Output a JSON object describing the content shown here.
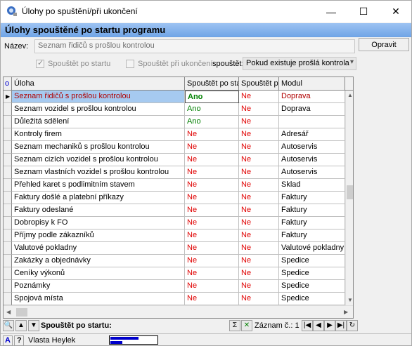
{
  "window": {
    "title": "Úlohy po spuštění/při ukončení",
    "minimize": "—",
    "maximize": "☐",
    "close": "✕"
  },
  "section_header": "Úlohy spouštěné po startu programu",
  "form": {
    "name_label": "Název:",
    "name_value": "Seznam řidičů s prošlou kontrolou",
    "open_button": "Opravit",
    "run_on_start_label": "Spouštět po startu",
    "run_on_start_checked": true,
    "run_on_exit_label": "Spouštět při ukončení",
    "run_on_exit_checked": false,
    "run_condition_label": "spouštět:",
    "run_condition_value": "Pokud existuje prošlá kontrola"
  },
  "grid": {
    "indicator_header": "o",
    "columns": [
      "Úloha",
      "Spouštět po sta",
      "Spouštět pi",
      "Modul"
    ],
    "rows": [
      {
        "task": "Seznam řidičů s prošlou kontrolou",
        "start": "Ano",
        "exit": "Ne",
        "module": "Doprava",
        "selected": true
      },
      {
        "task": "Seznam vozidel s prošlou kontrolou",
        "start": "Ano",
        "exit": "Ne",
        "module": "Doprava"
      },
      {
        "task": "Důležitá sdělení",
        "start": "Ano",
        "exit": "Ne",
        "module": ""
      },
      {
        "task": "Kontroly firem",
        "start": "Ne",
        "exit": "Ne",
        "module": "Adresář"
      },
      {
        "task": "Seznam mechaniků s prošlou kontrolou",
        "start": "Ne",
        "exit": "Ne",
        "module": "Autoservis"
      },
      {
        "task": "Seznam cizích vozidel s prošlou kontrolou",
        "start": "Ne",
        "exit": "Ne",
        "module": "Autoservis"
      },
      {
        "task": "Seznam vlastních vozidel s prošlou kontrolou",
        "start": "Ne",
        "exit": "Ne",
        "module": "Autoservis"
      },
      {
        "task": "Přehled karet s podlimitním stavem",
        "start": "Ne",
        "exit": "Ne",
        "module": "Sklad"
      },
      {
        "task": "Faktury došlé a platební příkazy",
        "start": "Ne",
        "exit": "Ne",
        "module": "Faktury"
      },
      {
        "task": "Faktury odeslané",
        "start": "Ne",
        "exit": "Ne",
        "module": "Faktury"
      },
      {
        "task": "Dobropisy k FO",
        "start": "Ne",
        "exit": "Ne",
        "module": "Faktury"
      },
      {
        "task": "Příjmy podle zákazníků",
        "start": "Ne",
        "exit": "Ne",
        "module": "Faktury"
      },
      {
        "task": "Valutové pokladny",
        "start": "Ne",
        "exit": "Ne",
        "module": "Valutové pokladny"
      },
      {
        "task": "Zakázky a objednávky",
        "start": "Ne",
        "exit": "Ne",
        "module": "Spedice"
      },
      {
        "task": "Ceníky výkonů",
        "start": "Ne",
        "exit": "Ne",
        "module": "Spedice"
      },
      {
        "task": "Poznámky",
        "start": "Ne",
        "exit": "Ne",
        "module": "Spedice"
      },
      {
        "task": "Spojová místa",
        "start": "Ne",
        "exit": "Ne",
        "module": "Spedice"
      }
    ]
  },
  "navbar": {
    "search_icon": "🔍",
    "up": "▲",
    "down": "▼",
    "label": "Spouštět po startu:",
    "sum": "Σ",
    "record_label": "Záznam č.: 1",
    "first": "|◀",
    "prev": "◀",
    "next": "▶",
    "last": "▶|",
    "refresh": "↻"
  },
  "status": {
    "a_button": "A",
    "help_button": "?",
    "user": "Vlasta Heylek",
    "progress1": 0.6,
    "progress2": 0.25
  }
}
